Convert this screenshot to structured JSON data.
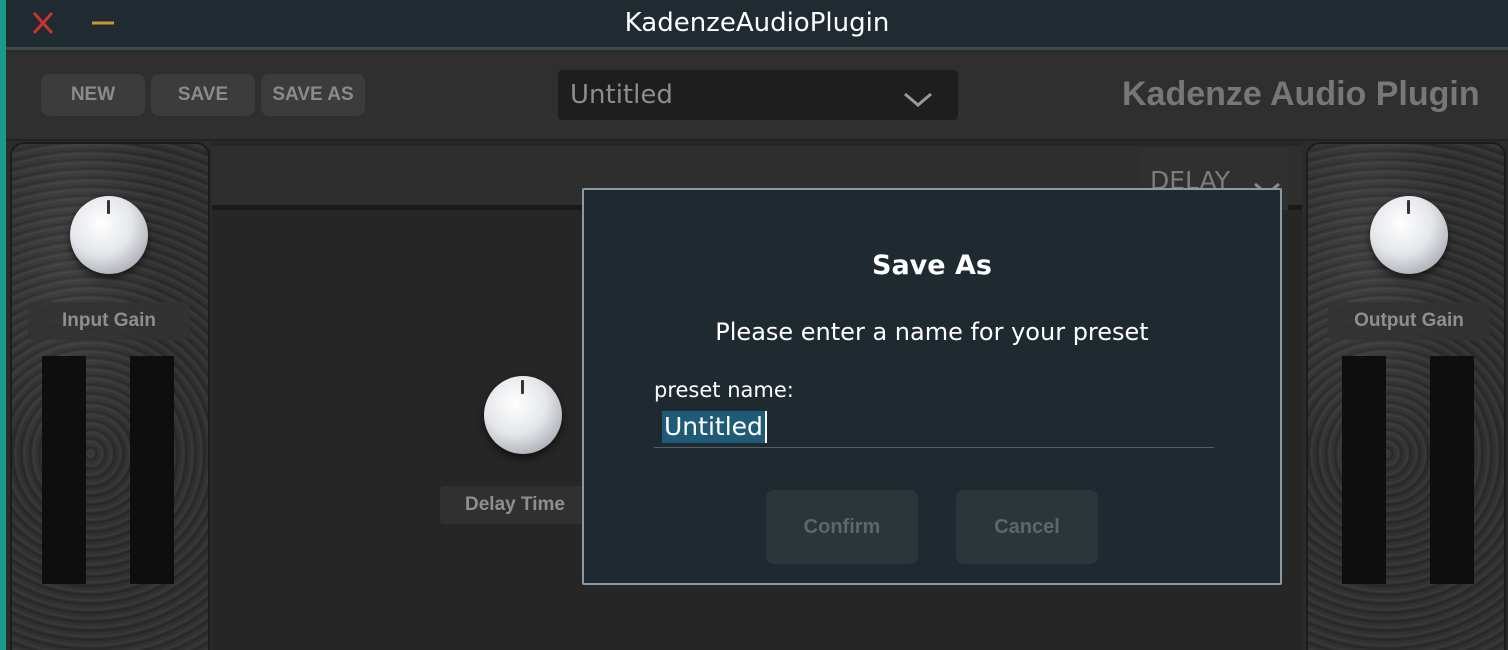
{
  "window": {
    "title": "KadenzeAudioPlugin"
  },
  "toolbar": {
    "new_label": "NEW",
    "save_label": "SAVE",
    "save_as_label": "SAVE AS",
    "preset_select_value": "Untitled",
    "brand": "Kadenze Audio Plugin"
  },
  "input_panel": {
    "label": "Input Gain"
  },
  "output_panel": {
    "label": "Output Gain"
  },
  "center": {
    "fx_select_value": "DELAY",
    "delay_time_label": "Delay Time"
  },
  "dialog": {
    "title": "Save As",
    "message": "Please enter a name for your preset",
    "field_label": "preset name:",
    "field_value": "Untitled",
    "confirm_label": "Confirm",
    "cancel_label": "Cancel"
  },
  "colors": {
    "accent_edge": "#1a9a8a",
    "close_icon": "#c8342c",
    "minimize_icon": "#c8962c",
    "text_selection": "#1f5b77"
  },
  "icons": [
    "close-icon",
    "minimize-icon",
    "chevron-down-icon",
    "knob-icon"
  ]
}
